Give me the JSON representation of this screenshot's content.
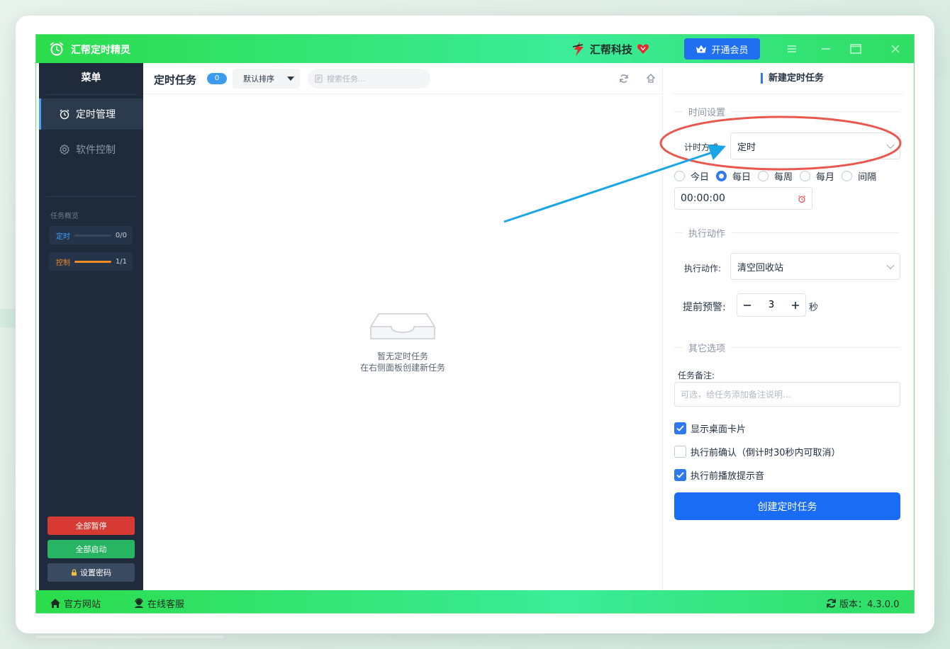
{
  "app": {
    "title": "汇帮定时精灵",
    "brand_name": "汇帮科技",
    "vip_button": "开通会员",
    "accent": "#1a6cf5",
    "titlebar_green": "#2bdc4b"
  },
  "sidebar": {
    "menu_title": "菜单",
    "items": [
      {
        "label": "定时管理",
        "icon": "alarm-clock-icon",
        "active": true
      },
      {
        "label": "软件控制",
        "icon": "gear-icon",
        "active": false
      }
    ],
    "overview_title": "任务概览",
    "overview": [
      {
        "label": "定时",
        "count": "0/0",
        "progress": 0,
        "color": "#3fa0ff"
      },
      {
        "label": "控制",
        "count": "1/1",
        "progress": 1,
        "color": "#f08a24"
      }
    ],
    "buttons": {
      "pause_all": "全部暂停",
      "start_all": "全部启动",
      "set_password": "设置密码"
    }
  },
  "center": {
    "title": "定时任务",
    "task_count": "0",
    "sort_label": "默认排序",
    "search_placeholder": "搜索任务...",
    "empty_title": "暂无定时任务",
    "empty_hint": "在右侧面板创建新任务"
  },
  "right_panel": {
    "title": "新建定时任务",
    "time_section": "时间设置",
    "timing_mode_label": "计时方式:",
    "timing_mode_value": "定时",
    "frequency_options": [
      "今日",
      "每日",
      "每周",
      "每月",
      "间隔"
    ],
    "frequency_selected": "每日",
    "time_value": "00:00:00",
    "action_section": "执行动作",
    "action_label": "执行动作:",
    "action_value": "清空回收站",
    "warning_label": "提前预警:",
    "warning_value": "3",
    "warning_unit": "秒",
    "other_section": "其它选项",
    "note_label": "任务备注:",
    "note_placeholder": "可选，给任务添加备注说明...",
    "checkboxes": [
      {
        "label": "显示桌面卡片",
        "checked": true
      },
      {
        "label": "执行前确认（倒计时30秒内可取消）",
        "checked": false
      },
      {
        "label": "执行前播放提示音",
        "checked": true
      }
    ],
    "create_button": "创建定时任务"
  },
  "statusbar": {
    "website": "官方网站",
    "support": "在线客服",
    "version": "版本：4.3.0.0"
  }
}
